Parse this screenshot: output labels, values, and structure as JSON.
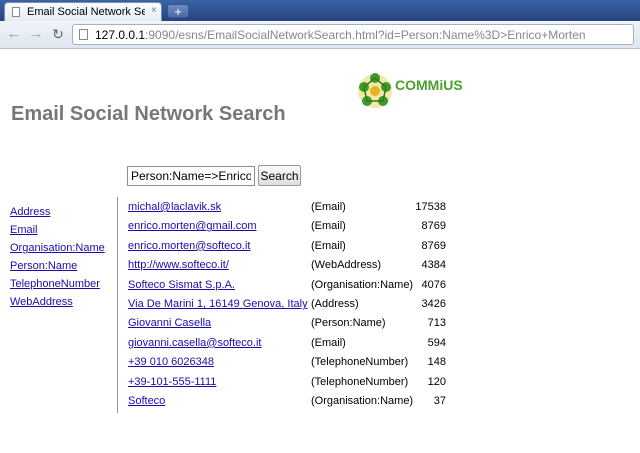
{
  "browser": {
    "tab_title": "Email Social Network Sea...",
    "tab_close": "×",
    "new_tab": "+",
    "url_host": "127.0.0.1",
    "url_rest": ":9090/esns/EmailSocialNetworkSearch.html?id=Person:Name%3D>Enrico+Morten"
  },
  "logo": {
    "text": "COMMiUS"
  },
  "page": {
    "title": "Email Social Network Search",
    "search_value": "Person:Name=>Enrico Mo",
    "search_button": "Search"
  },
  "sidebar": {
    "items": [
      {
        "label": "Address"
      },
      {
        "label": "Email"
      },
      {
        "label": "Organisation:Name"
      },
      {
        "label": "Person:Name"
      },
      {
        "label": "TelephoneNumber"
      },
      {
        "label": "WebAddress"
      }
    ]
  },
  "results": [
    {
      "value": "michal@laclavik.sk",
      "type": "(Email)",
      "count": "17538",
      "link": true
    },
    {
      "value": "enrico.morten@gmail.com",
      "type": "(Email)",
      "count": "8769",
      "link": true
    },
    {
      "value": "enrico.morten@softeco.it",
      "type": "(Email)",
      "count": "8769",
      "link": true
    },
    {
      "value": "http://www.softeco.it/",
      "type": "(WebAddress)",
      "count": "4384",
      "link": true
    },
    {
      "value": "Softeco Sismat S.p.A.",
      "type": "(Organisation:Name)",
      "count": "4076",
      "link": true
    },
    {
      "value": "Via De Marini 1, 16149 Genova, Italy",
      "type": "(Address)",
      "count": "3426",
      "link": true
    },
    {
      "value": "Giovanni Casella",
      "type": "(Person:Name)",
      "count": "713",
      "link": true
    },
    {
      "value": "giovanni.casella@softeco.it",
      "type": "(Email)",
      "count": "594",
      "link": true
    },
    {
      "value": "+39 010 6026348",
      "type": "(TelephoneNumber)",
      "count": "148",
      "link": true
    },
    {
      "value": "+39-101-555-1111",
      "type": "(TelephoneNumber)",
      "count": "120",
      "link": true
    },
    {
      "value": "Softeco",
      "type": "(Organisation:Name)",
      "count": "37",
      "link": true
    }
  ]
}
